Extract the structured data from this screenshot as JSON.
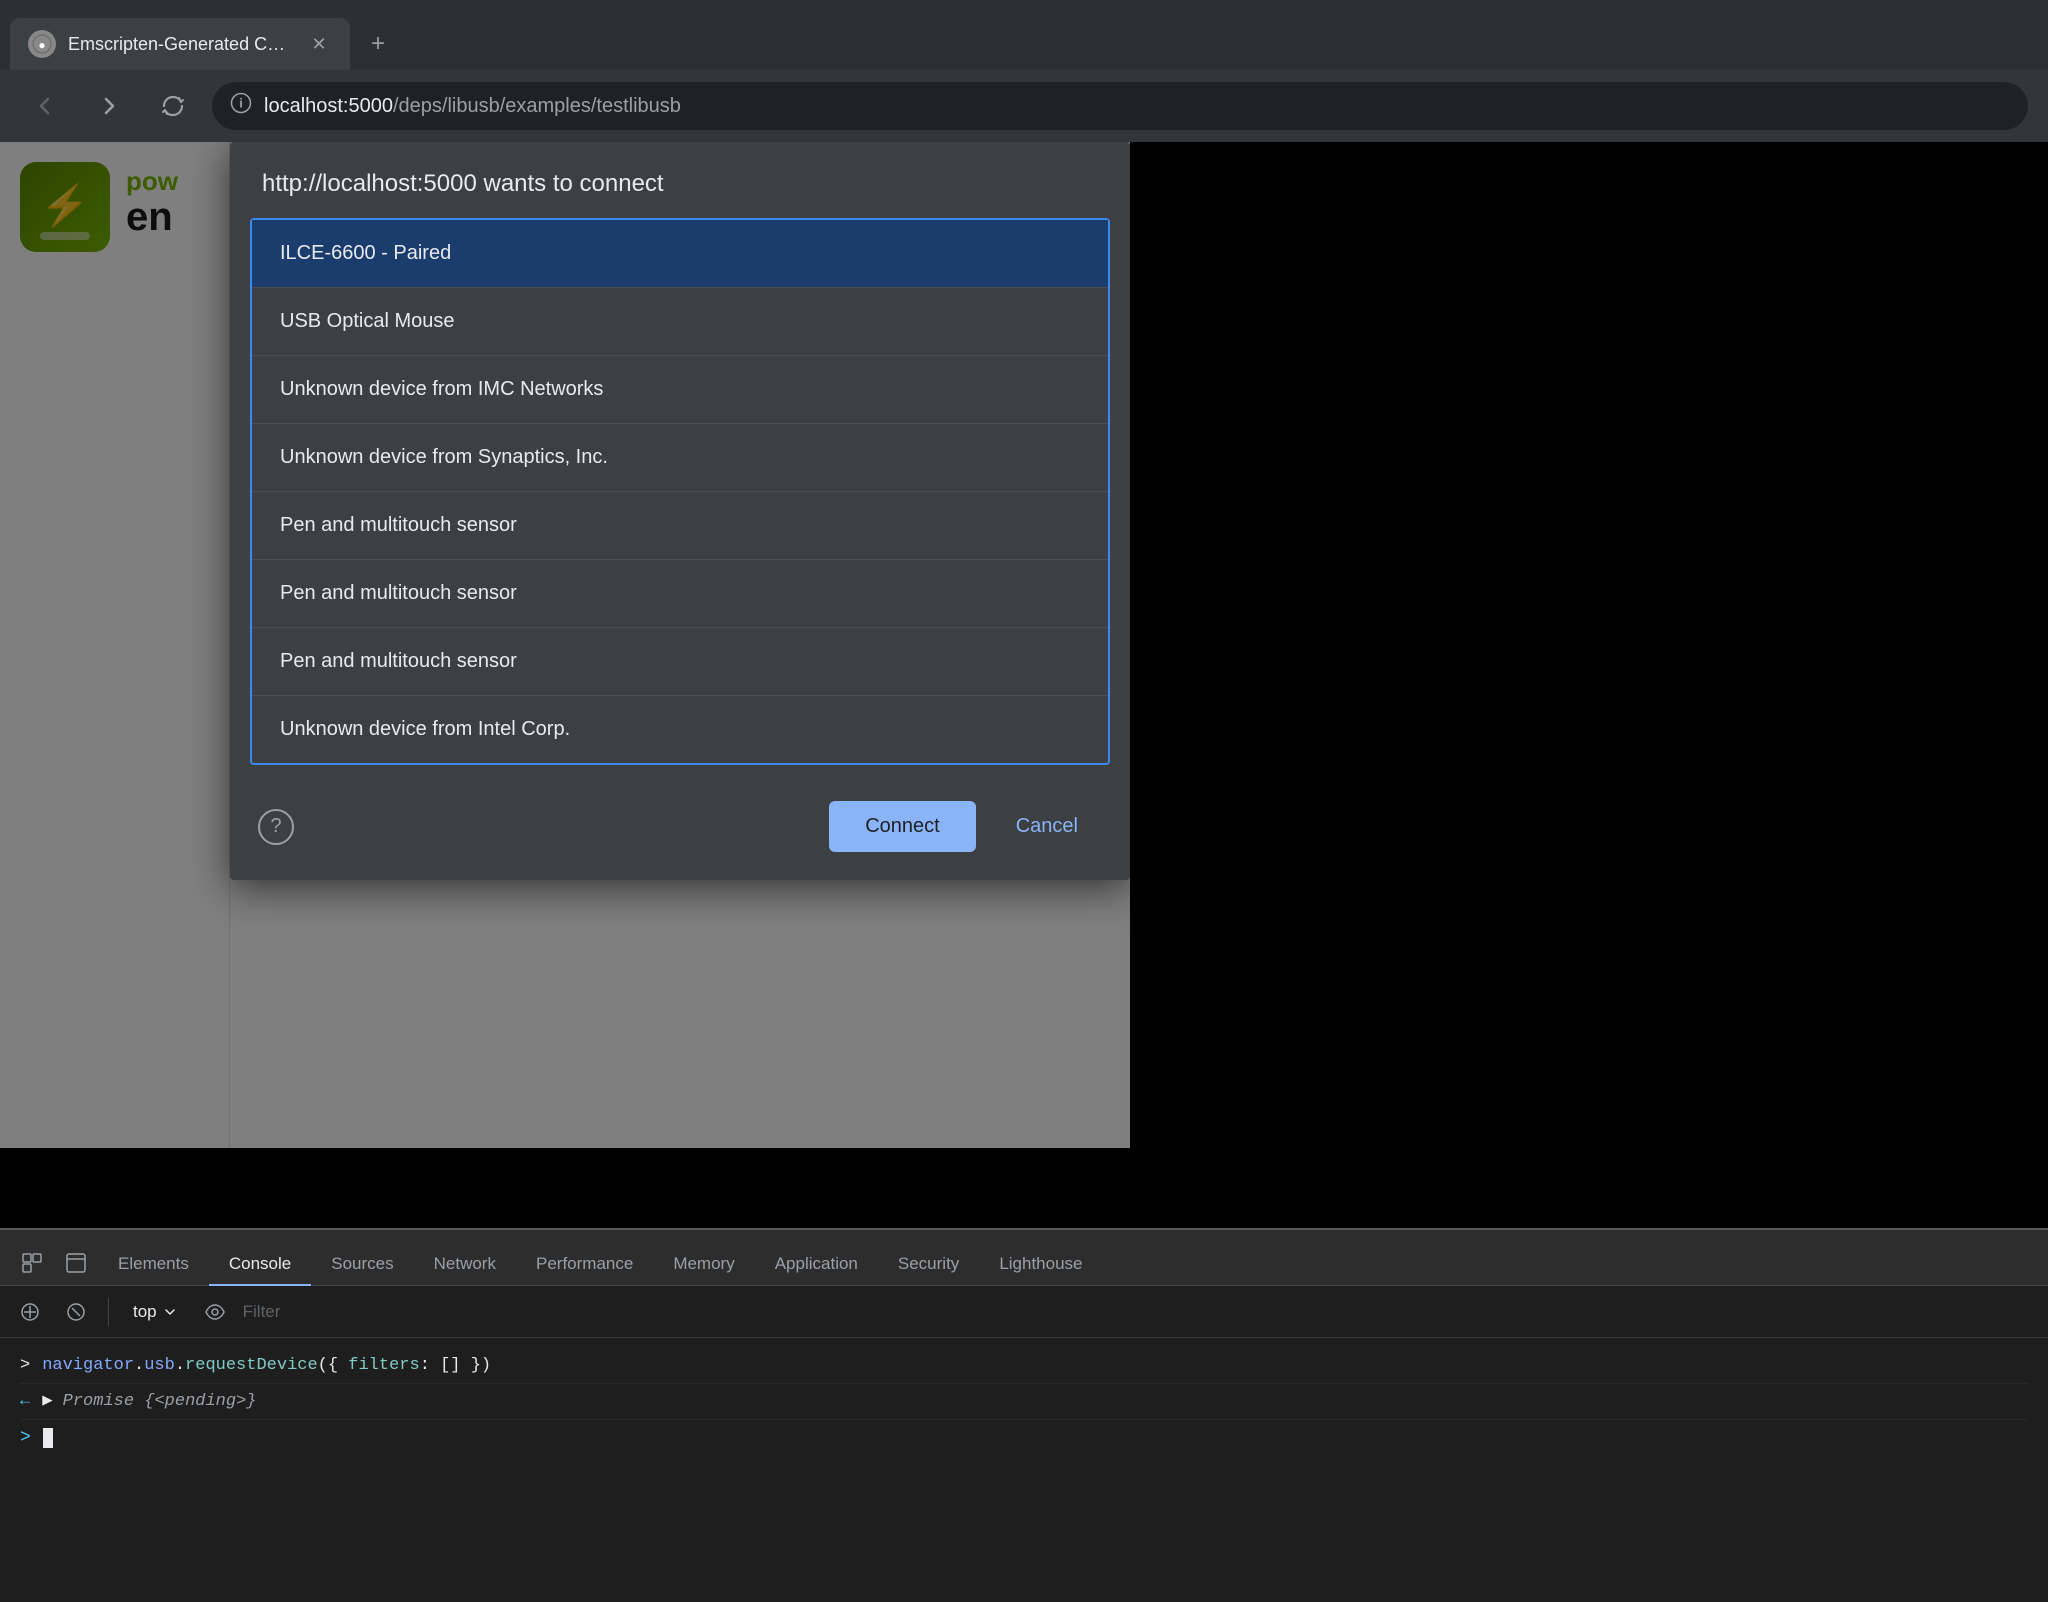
{
  "browser": {
    "tab": {
      "title": "Emscripten-Generated Code",
      "favicon": "●"
    },
    "new_tab_icon": "+",
    "nav": {
      "back": "←",
      "forward": "→",
      "reload": "↻",
      "url_info": "ⓘ",
      "url_domain": "localhost:5000",
      "url_path": "/deps/libusb/examples/testlibusb"
    }
  },
  "app": {
    "icon_symbol": "⚡",
    "text_pow": "pow",
    "text_en": "en"
  },
  "dialog": {
    "title": "http://localhost:5000 wants to connect",
    "devices": [
      {
        "name": "ILCE-6600 - Paired",
        "selected": true
      },
      {
        "name": "USB Optical Mouse",
        "selected": false
      },
      {
        "name": "Unknown device from IMC Networks",
        "selected": false
      },
      {
        "name": "Unknown device from Synaptics, Inc.",
        "selected": false
      },
      {
        "name": "Pen and multitouch sensor",
        "selected": false
      },
      {
        "name": "Pen and multitouch sensor",
        "selected": false
      },
      {
        "name": "Pen and multitouch sensor",
        "selected": false
      },
      {
        "name": "Unknown device from Intel Corp.",
        "selected": false
      }
    ],
    "connect_label": "Connect",
    "cancel_label": "Cancel"
  },
  "devtools": {
    "tabs": [
      {
        "label": "Elements",
        "active": false
      },
      {
        "label": "Console",
        "active": true
      },
      {
        "label": "Sources",
        "active": false
      },
      {
        "label": "Network",
        "active": false
      },
      {
        "label": "Performance",
        "active": false
      },
      {
        "label": "Memory",
        "active": false
      },
      {
        "label": "Application",
        "active": false
      },
      {
        "label": "Security",
        "active": false
      },
      {
        "label": "Lighthouse",
        "active": false
      }
    ],
    "toolbar": {
      "top_label": "top",
      "filter_placeholder": "Filter"
    },
    "console_entries": [
      {
        "arrow": ">",
        "code_html": "<span class='kw'>navigator</span><span class='punct'>.</span><span class='obj'>usb</span><span class='punct'>.</span><span class='prop'>requestDevice</span><span class='punct'>({</span> <span class='prop'>filters</span><span class='punct'>:</span> <span class='punct'>[]</span> <span class='punct'>})</span>"
      }
    ],
    "promise_result": "Promise {<pending>}"
  }
}
